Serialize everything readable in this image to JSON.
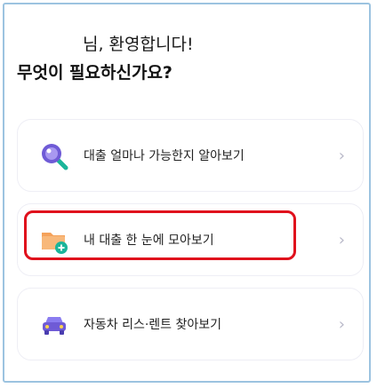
{
  "header": {
    "greeting_line1": "님, 환영합니다!",
    "greeting_line2": "무엇이 필요하신가요?"
  },
  "menu": {
    "items": [
      {
        "label": "대출 얼마나 가능한지 알아보기",
        "icon": "magnifier-icon",
        "chevron": "›"
      },
      {
        "label": "내 대출 한 눈에 모아보기",
        "icon": "folder-plus-icon",
        "chevron": "›"
      },
      {
        "label": "자동차 리스·렌트 찾아보기",
        "icon": "car-icon",
        "chevron": "›"
      }
    ]
  },
  "colors": {
    "highlight": "#e0101c",
    "card_border": "#eeeef5",
    "chevron": "#b8b8c8",
    "icon_purple": "#6f5bd6",
    "icon_orange": "#f5a25a",
    "icon_teal": "#1bb59a"
  }
}
